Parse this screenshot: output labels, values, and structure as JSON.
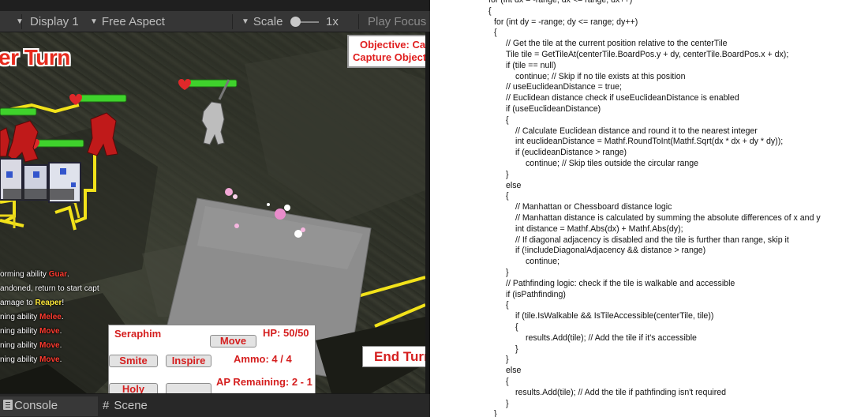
{
  "toolbar": {
    "display": "Display 1",
    "aspect": "Free Aspect",
    "scale_label": "Scale",
    "scale_value": "1x",
    "play_focus": "Play Focus"
  },
  "hud": {
    "turn_title": "er Turn",
    "objective_line1": "Objective: Cap",
    "objective_line2": "Capture Objecti",
    "log": [
      {
        "white": "orming ability ",
        "red": "Guar",
        "yellow": "",
        "tail": "."
      },
      {
        "white": "andoned, return to start capt",
        "red": "",
        "yellow": "",
        "tail": ""
      },
      {
        "white": "amage to ",
        "red": "",
        "yellow": "Reaper",
        "tail": "!"
      },
      {
        "white": "ning ability ",
        "red": "Melee",
        "yellow": "",
        "tail": "."
      },
      {
        "white": "ning ability ",
        "red": "Move",
        "yellow": "",
        "tail": "."
      },
      {
        "white": "ning ability ",
        "red": "Move",
        "yellow": "",
        "tail": "."
      },
      {
        "white": "ning ability ",
        "red": "Move",
        "yellow": "",
        "tail": "."
      }
    ],
    "unit": {
      "name": "Seraphim",
      "hp": "HP: 50/50",
      "ammo": "Ammo: 4 / 4",
      "ap": "AP Remaining: 2 - 1",
      "abilities": [
        "Move",
        "Smite",
        "Inspire",
        "Holy Light",
        ""
      ]
    },
    "end_turn": "End Turn"
  },
  "tabs": {
    "console": "Console",
    "scene": "Scene"
  },
  "code": {
    "lines": [
      {
        "indent": 0,
        "text": "for (int dx = -range; dx <= range; dx++)"
      },
      {
        "indent": 0,
        "text": "{"
      },
      {
        "indent": 1,
        "text": "for (int dy = -range; dy <= range; dy++)"
      },
      {
        "indent": 1,
        "text": "{"
      },
      {
        "indent": 2,
        "text": "// Get the tile at the current position relative to the centerTile"
      },
      {
        "indent": 2,
        "text": "Tile tile = GetTileAt(centerTile.BoardPos.y + dy, centerTile.BoardPos.x + dx);"
      },
      {
        "indent": 2,
        "text": "if (tile == null)"
      },
      {
        "indent": 3,
        "text": "continue; // Skip if no tile exists at this position"
      },
      {
        "indent": 2,
        "text": "// useEuclideanDistance = true;"
      },
      {
        "indent": 2,
        "text": "// Euclidean distance check if useEuclideanDistance is enabled"
      },
      {
        "indent": 2,
        "text": "if (useEuclideanDistance)"
      },
      {
        "indent": 2,
        "text": "{"
      },
      {
        "indent": 3,
        "text": "// Calculate Euclidean distance and round it to the nearest integer"
      },
      {
        "indent": 3,
        "text": "int euclideanDistance = Mathf.RoundToInt(Mathf.Sqrt(dx * dx + dy * dy));"
      },
      {
        "indent": 3,
        "text": "if (euclideanDistance > range)"
      },
      {
        "indent": 4,
        "text": "continue; // Skip tiles outside the circular range"
      },
      {
        "indent": 2,
        "text": "}"
      },
      {
        "indent": 2,
        "text": "else"
      },
      {
        "indent": 2,
        "text": "{"
      },
      {
        "indent": 3,
        "text": "// Manhattan or Chessboard distance logic"
      },
      {
        "indent": 3,
        "text": "// Manhattan distance is calculated by summing the absolute differences of x and y"
      },
      {
        "indent": 3,
        "text": "int distance = Mathf.Abs(dx) + Mathf.Abs(dy);"
      },
      {
        "indent": 3,
        "text": "// If diagonal adjacency is disabled and the tile is further than range, skip it"
      },
      {
        "indent": 3,
        "text": "if (!includeDiagonalAdjacency && distance > range)"
      },
      {
        "indent": 4,
        "text": "continue;"
      },
      {
        "indent": 2,
        "text": "}"
      },
      {
        "indent": 2,
        "text": "// Pathfinding logic: check if the tile is walkable and accessible"
      },
      {
        "indent": 2,
        "text": "if (isPathfinding)"
      },
      {
        "indent": 2,
        "text": "{"
      },
      {
        "indent": 3,
        "text": "if (tile.IsWalkable && IsTileAccessible(centerTile, tile))"
      },
      {
        "indent": 3,
        "text": "{"
      },
      {
        "indent": 4,
        "text": "results.Add(tile); // Add the tile if it's accessible"
      },
      {
        "indent": 3,
        "text": "}"
      },
      {
        "indent": 2,
        "text": "}"
      },
      {
        "indent": 2,
        "text": "else"
      },
      {
        "indent": 2,
        "text": "{"
      },
      {
        "indent": 3,
        "text": "results.Add(tile); // Add the tile if pathfinding isn't required"
      },
      {
        "indent": 2,
        "text": "}"
      },
      {
        "indent": 1,
        "text": "}"
      }
    ]
  },
  "colors": {
    "hud_red": "#d51f1f",
    "health_green": "#3fd22c",
    "grid_yellow": "#f2e21a"
  }
}
